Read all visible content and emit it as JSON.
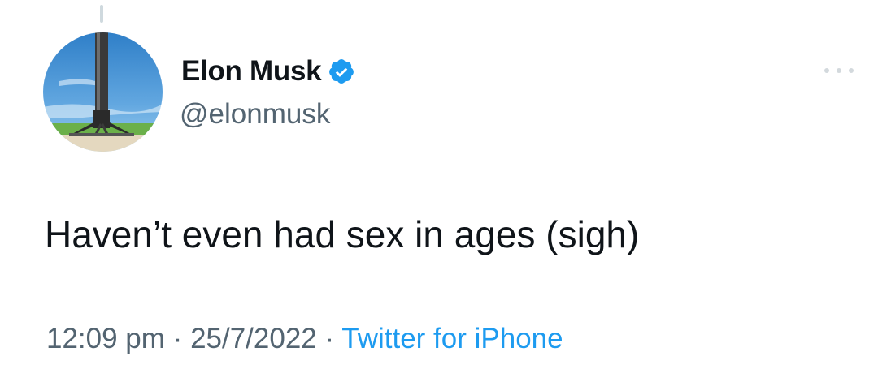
{
  "tweet": {
    "author": {
      "display_name": "Elon Musk",
      "handle": "@elonmusk",
      "verified": true,
      "avatar_icon": "rocket-booster-avatar"
    },
    "text": "Haven’t even had sex in ages (sigh)",
    "time": "12:09 pm",
    "date": "25/7/2022",
    "separator": "·",
    "source": "Twitter for iPhone",
    "more_icon": "more-options-icon"
  },
  "colors": {
    "text": "#0f1419",
    "secondary": "#536471",
    "accent": "#1d9bf0",
    "thread_line": "#cfd9de"
  }
}
